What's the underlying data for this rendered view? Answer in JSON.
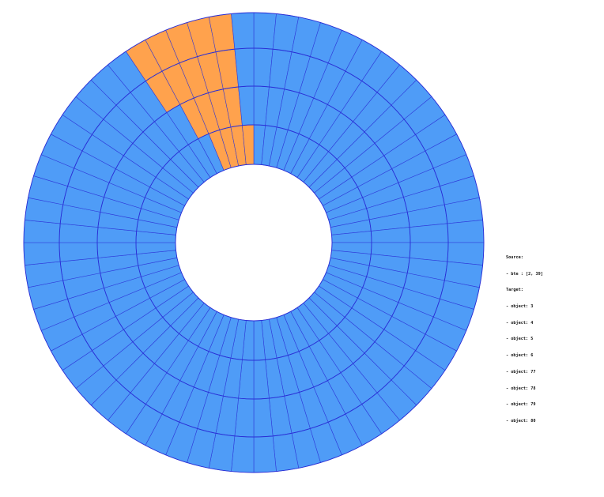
{
  "colors": {
    "cell_fill": "#4f9cf7",
    "highlight_fill": "#ffa24d",
    "stroke": "#2a2fd6",
    "background": "#ffffff"
  },
  "diagram": {
    "rings": 4,
    "sectors_per_ring": 64,
    "highlighted_cells": [
      {
        "ring": 0,
        "sectors": [
          60,
          61,
          62,
          63
        ]
      },
      {
        "ring": 1,
        "sectors": [
          59,
          60,
          61,
          62
        ]
      },
      {
        "ring": 2,
        "sectors": [
          58,
          59,
          60,
          61,
          62
        ]
      },
      {
        "ring": 3,
        "sectors": [
          58,
          59,
          60,
          61,
          62
        ]
      }
    ]
  },
  "legend": {
    "source_heading": "Source:",
    "source_item": "- bte : [2, 39]",
    "target_heading": "Target:",
    "target_items": [
      "- object: 3",
      "- object: 4",
      "- object: 5",
      "- object: 6",
      "- object: 77",
      "- object: 78",
      "- object: 79",
      "- object: 80"
    ]
  }
}
